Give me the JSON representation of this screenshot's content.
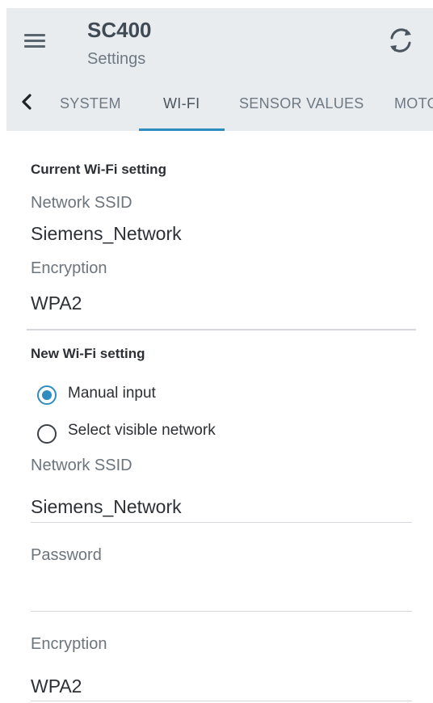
{
  "header": {
    "title": "SC400",
    "subtitle": "Settings",
    "menu_icon": "hamburger-menu-icon",
    "refresh_icon": "refresh-icon"
  },
  "tabs": [
    {
      "label": "SYSTEM",
      "active": false
    },
    {
      "label": "WI-FI",
      "active": true
    },
    {
      "label": "SENSOR VALUES",
      "active": false
    },
    {
      "label": "MOTOR",
      "active": false
    }
  ],
  "current_wifi": {
    "title": "Current Wi-Fi setting",
    "ssid_label": "Network SSID",
    "ssid_value": "Siemens_Network",
    "encryption_label": "Encryption",
    "encryption_value": "WPA2"
  },
  "new_wifi": {
    "title": "New Wi-Fi setting",
    "options": [
      {
        "label": "Manual input",
        "selected": true
      },
      {
        "label": "Select visible network",
        "selected": false
      }
    ],
    "ssid_label": "Network SSID",
    "ssid_value": "Siemens_Network",
    "password_label": "Password",
    "password_value": "",
    "encryption_label": "Encryption",
    "encryption_value": "WPA2"
  },
  "colors": {
    "accent": "#2e8cbf",
    "header_bg": "#e9ecef"
  }
}
